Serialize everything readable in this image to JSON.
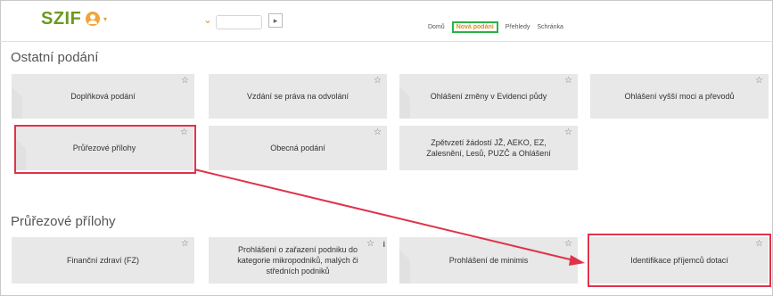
{
  "header": {
    "logo": "SZIF"
  },
  "nav": {
    "items": [
      "Domů",
      "Nová podání",
      "Přehledy",
      "Schránka"
    ],
    "active_index": 1
  },
  "sections": {
    "other": {
      "title": "Ostatní podání"
    },
    "cross": {
      "title": "Průřezové přílohy"
    }
  },
  "tiles_other": [
    "Doplňková podání",
    "Vzdání se práva na odvolání",
    "Ohlášení změny v Evidenci půdy",
    "Ohlášení vyšší moci a převodů",
    "Průřezové přílohy",
    "Obecná podání",
    "Zpětvzetí žádostí JŽ, AEKO, EZ, Zalesnění, Lesů, PUZČ a Ohlášení"
  ],
  "tiles_cross": [
    "Finanční zdraví (FZ)",
    "Prohlášení o zařazení podniku do kategorie mikropodniků, malých či středních podniků",
    "Prohlášení de minimis",
    "Identifikace příjemců dotací"
  ],
  "annotation": {
    "color": "#e0334a",
    "active_nav_color": "#28b34a",
    "brand_color": "#6a9a1f"
  }
}
